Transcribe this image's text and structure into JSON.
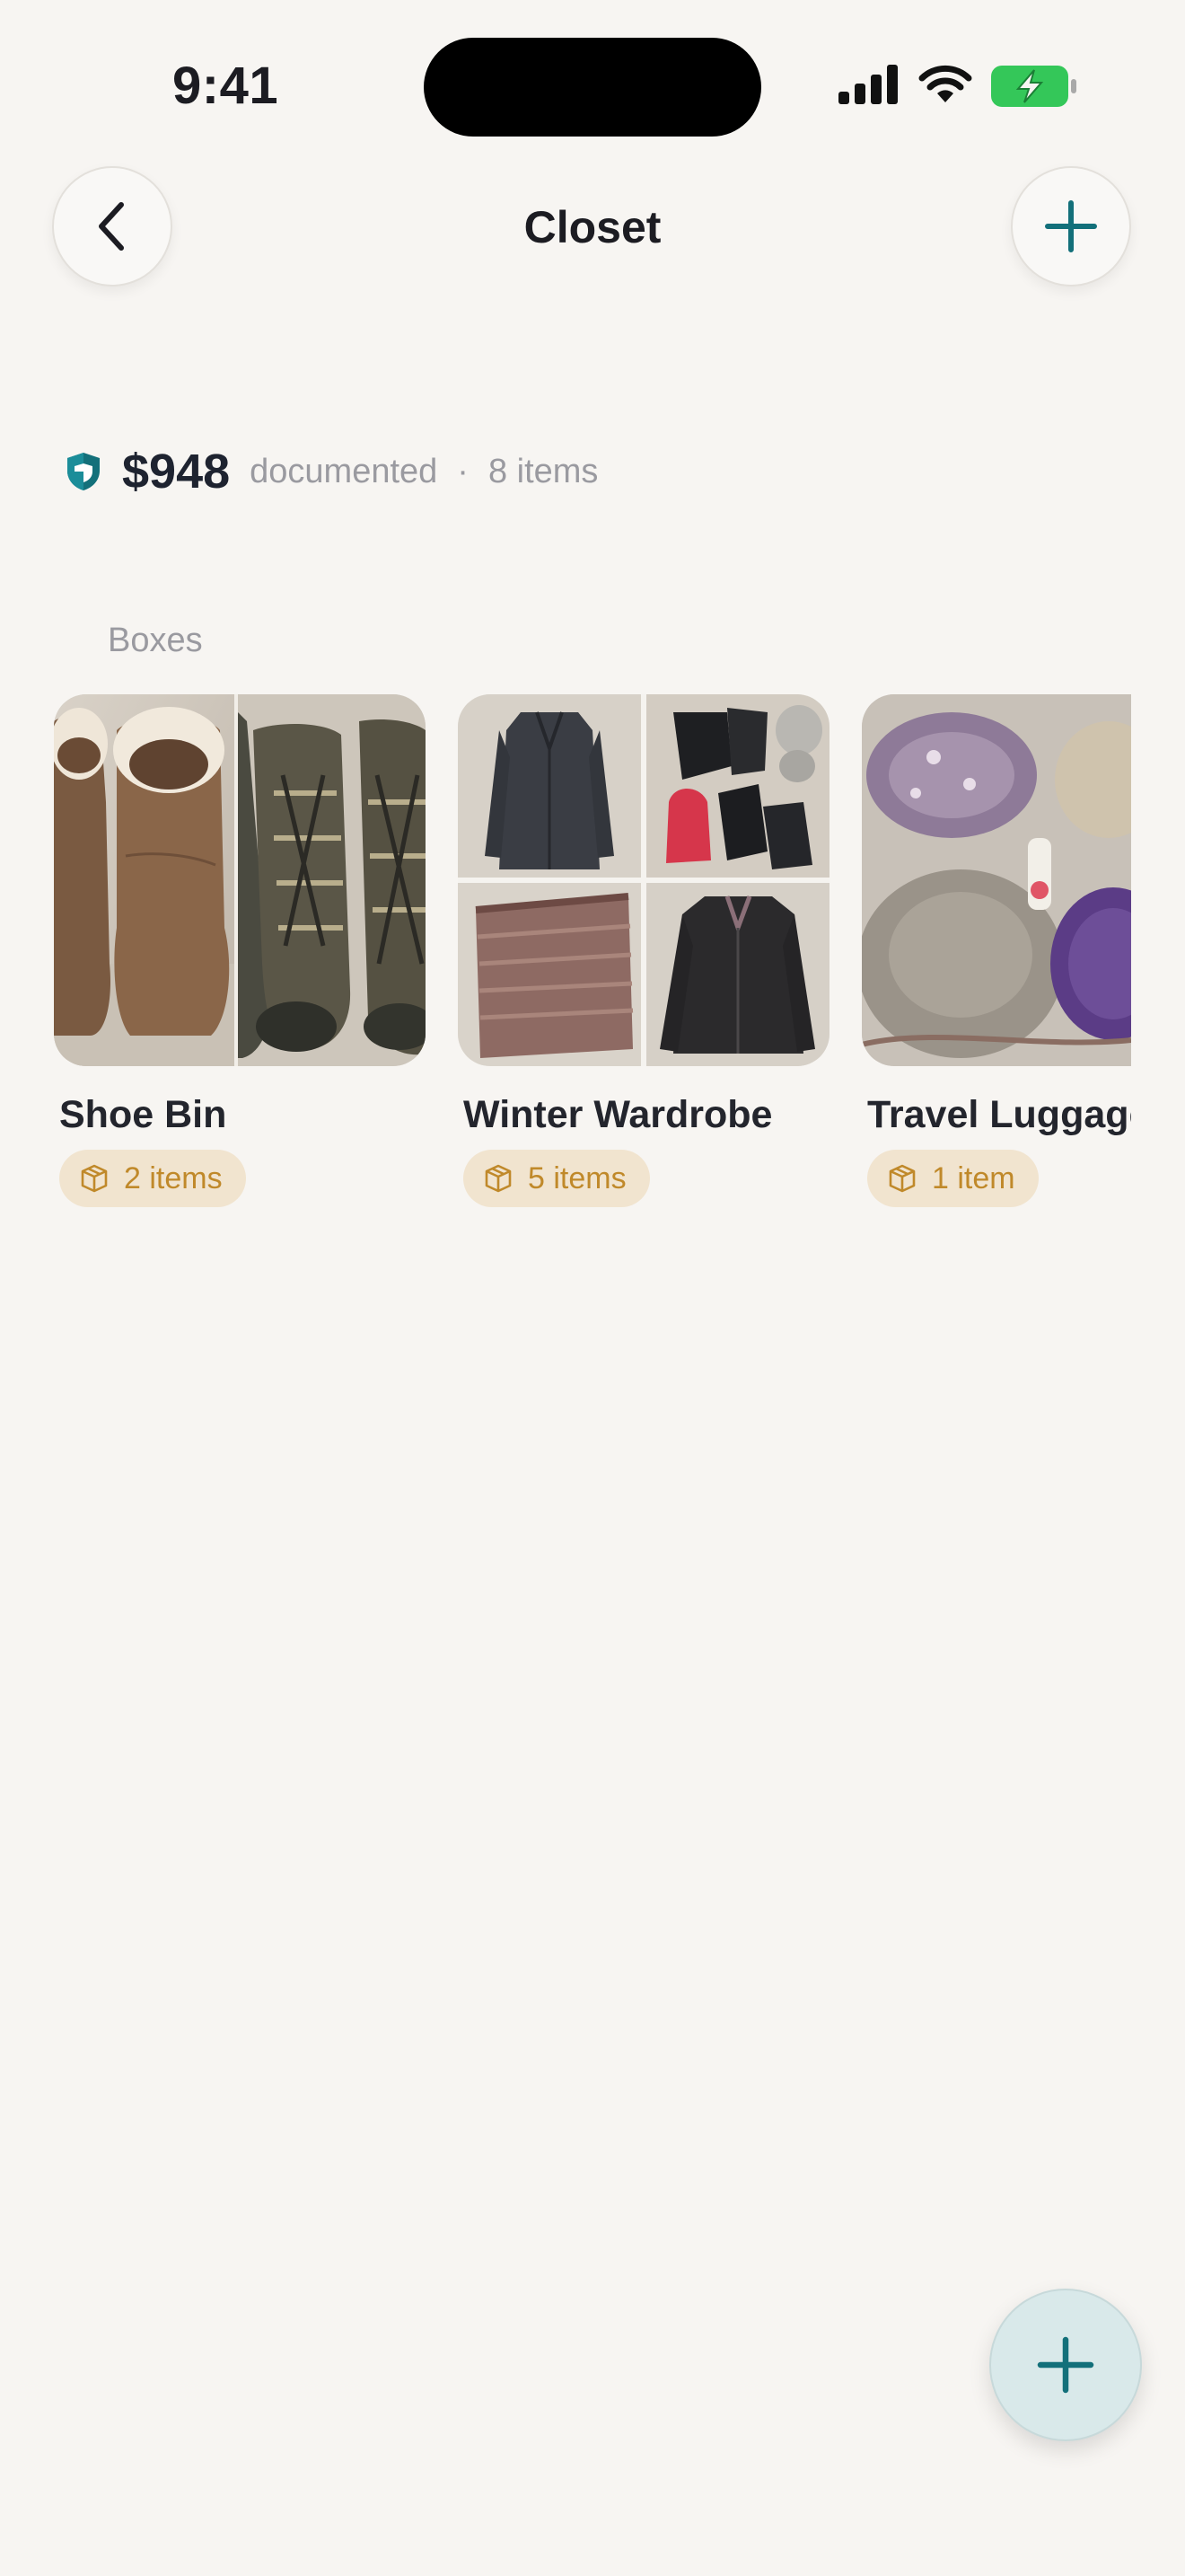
{
  "status_bar": {
    "time": "9:41",
    "icons": [
      "cellular-signal-icon",
      "wifi-icon",
      "battery-charging-icon"
    ]
  },
  "nav": {
    "title": "Closet",
    "back_icon": "chevron-left-icon",
    "add_icon": "plus-icon"
  },
  "summary": {
    "icon": "shield-icon",
    "amount": "$948",
    "label": "documented",
    "separator": "·",
    "count": "8 items"
  },
  "boxes_section": {
    "title": "Boxes",
    "items": [
      {
        "name": "Shoe Bin",
        "count": "2 items",
        "photos": [
          "brown sheepskin boots",
          "brown sport sandals"
        ]
      },
      {
        "name": "Winter Wardrobe",
        "count": "5 items",
        "photos": [
          "charcoal wool coat",
          "gloves and mittens",
          "striped scarf",
          "black leather jacket"
        ]
      },
      {
        "name": "Travel Luggage",
        "count": "1 item",
        "photos": [
          "hats and sunscreen"
        ]
      }
    ]
  },
  "fab": {
    "icon": "plus-icon"
  },
  "colors": {
    "background": "#f7f5f2",
    "accent_teal": "#13707a",
    "pill_bg": "#f1e4cf",
    "pill_text": "#c0892a",
    "battery_green": "#34c759"
  }
}
